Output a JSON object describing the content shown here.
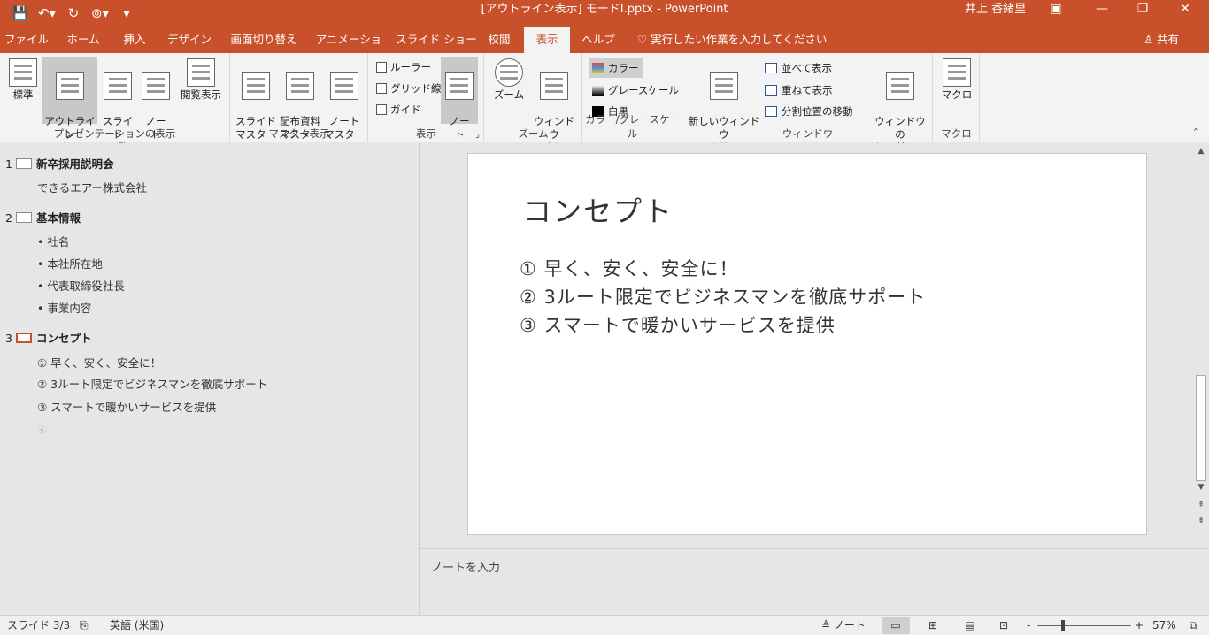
{
  "titlebar": {
    "qat": [
      "💾",
      "↶▾",
      "↻",
      "⊚▾",
      "▾"
    ],
    "title": "[アウトライン表示] モードⅠ.pptx  -  PowerPoint",
    "user": "井上 香緒里",
    "ribbon_display_icon": "▣",
    "minimize": "—",
    "restore": "❐",
    "close": "✕"
  },
  "tabs": {
    "items": [
      "ファイル",
      "ホーム",
      "挿入",
      "デザイン",
      "画面切り替え",
      "アニメーション",
      "スライド ショー",
      "校閲",
      "表示",
      "ヘルプ"
    ],
    "active_index": 8,
    "tell_me": "♡ 実行したい作業を入力してください",
    "share": "♙ 共有"
  },
  "ribbon": {
    "group_presentation_views": {
      "label": "プレゼンテーションの表示",
      "normal": "標準",
      "outline": "アウトライン\n表示",
      "slide_sorter": "スライド\n一覧",
      "notes": "ノー\nト",
      "reading": "閲覧表示"
    },
    "group_master_views": {
      "label": "マスター表示",
      "slide_master": "スライド\nマスター",
      "handout_master": "配布資料\nマスター",
      "notes_master": "ノート\nマスター"
    },
    "group_show": {
      "label": "表示",
      "ruler": "ルーラー",
      "gridlines": "グリッド線",
      "guides": "ガイド",
      "notes": "ノー\nト",
      "launcher": "⌟"
    },
    "group_zoom": {
      "label": "ズーム",
      "zoom": "ズーム",
      "fit": "ウィンドウ\nに合わせる"
    },
    "group_color": {
      "label": "カラー/グレースケール",
      "color": "カラー",
      "grayscale": "グレースケール",
      "bw": "白黒"
    },
    "group_window": {
      "label": "ウィンドウ",
      "new_window": "新しいウィンドウ\nを開く",
      "arrange": "並べて表示",
      "cascade": "重ねて表示",
      "split": "分割位置の移動",
      "switch": "ウィンドウの\n切り替え ▾"
    },
    "group_macro": {
      "label": "マクロ",
      "macro": "マクロ"
    },
    "collapse": "⌃"
  },
  "outline": {
    "slides": [
      {
        "num": "1",
        "title": "新卒採用説明会",
        "lines": [
          "できるエアー株式会社"
        ]
      },
      {
        "num": "2",
        "title": "基本情報",
        "lines": [
          "• 社名",
          "• 本社所在地",
          "• 代表取締役社長",
          "• 事業内容"
        ]
      },
      {
        "num": "3",
        "title": "コンセプト",
        "lines": [
          "① 早く、安く、安全に！",
          "② 3ルート限定でビジネスマンを徹底サポート",
          "③ スマートで暖かいサービスを提供",
          "④"
        ]
      }
    ]
  },
  "slide": {
    "title": "コンセプト",
    "body": [
      "① 早く、安く、安全に！",
      "② 3ルート限定でビジネスマンを徹底サポート",
      "③ スマートで暖かいサービスを提供"
    ]
  },
  "scroll": {
    "up": "▲",
    "down": "▼",
    "prev": "⇞",
    "next": "⇟"
  },
  "notes": {
    "placeholder": "ノートを入力"
  },
  "statusbar": {
    "slide": "スライド 3/3",
    "spell_icon": "⎘",
    "language": "英語 (米国)",
    "notes": "≜ ノート",
    "view_normal": "▭",
    "view_sorter": "⊞",
    "view_reading": "▤",
    "view_slideshow": "⊡",
    "zoom_minus": "-",
    "zoom_plus": "+",
    "zoom": "57%",
    "fit": "⧉"
  },
  "colors": {
    "accent": "#c8502a",
    "background": "#e6e6e6"
  }
}
